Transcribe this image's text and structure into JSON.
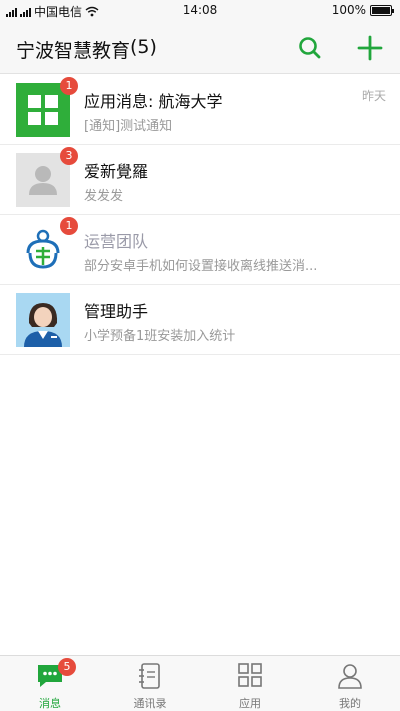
{
  "status_bar": {
    "carrier": "中国电信",
    "time": "14:08",
    "battery": "100%",
    "battery_level": 1.0
  },
  "header": {
    "title": "宁波智慧教育",
    "count": "(5)",
    "search_icon": "search-icon",
    "add_icon": "plus-icon"
  },
  "conversations": [
    {
      "name": "应用消息: 航海大学",
      "preview": "[通知]测试通知",
      "time": "昨天",
      "badge": "1",
      "avatar": "apps-grid-icon",
      "avatar_color": "#2fae3a"
    },
    {
      "name": "爱新覺羅",
      "preview": "发发发",
      "time": "",
      "badge": "3",
      "avatar": "default-person-icon",
      "avatar_color": "#d9d9d9"
    },
    {
      "name": "运营团队",
      "preview": "部分安卓手机如何设置接收离线推送消...",
      "time": "",
      "badge": "1",
      "avatar": "team-logo-icon",
      "avatar_color": "#1e6fb8"
    },
    {
      "name": "管理助手",
      "preview": "小学预备1班安装加入统计",
      "time": "",
      "badge": "",
      "avatar": "assistant-avatar-icon",
      "avatar_color": "#9ad0ee"
    }
  ],
  "tabbar": {
    "tabs": [
      {
        "label": "消息",
        "icon": "chat-icon",
        "badge": "5",
        "active": true
      },
      {
        "label": "通讯录",
        "icon": "contacts-book-icon",
        "badge": "",
        "active": false
      },
      {
        "label": "应用",
        "icon": "apps-grid-icon",
        "badge": "",
        "active": false
      },
      {
        "label": "我的",
        "icon": "person-icon",
        "badge": "",
        "active": false
      }
    ]
  },
  "colors": {
    "accent": "#21a63c",
    "badge": "#e64b3c"
  }
}
